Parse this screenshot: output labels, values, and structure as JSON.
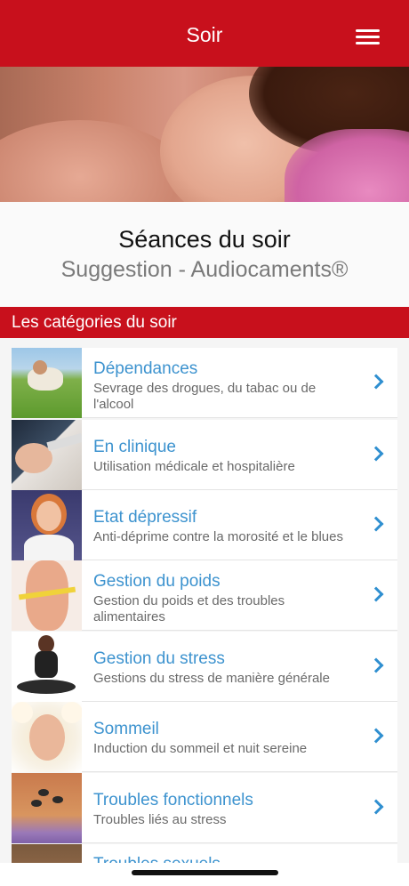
{
  "header": {
    "title": "Soir",
    "menu_icon": "hamburger-menu-icon"
  },
  "hero": {
    "image": "sleeping-woman-photo"
  },
  "intro": {
    "title": "Séances du soir",
    "subtitle": "Suggestion - Audiocaments®"
  },
  "section": {
    "label": "Les catégories du soir"
  },
  "categories": [
    {
      "title": "Dépendances",
      "desc": "Sevrage des drogues, du tabac ou de l'alcool",
      "thumb": "man-lying-in-grass"
    },
    {
      "title": "En clinique",
      "desc": "Utilisation médicale et hospitalière",
      "thumb": "dental-examination"
    },
    {
      "title": "Etat dépressif",
      "desc": "Anti-déprime contre la morosité et le blues",
      "thumb": "woman-holding-cup"
    },
    {
      "title": "Gestion du poids",
      "desc": "Gestion du poids et des troubles alimentaires",
      "thumb": "waist-measuring-tape"
    },
    {
      "title": "Gestion du stress",
      "desc": "Gestions du stress de manière générale",
      "thumb": "woman-meditating"
    },
    {
      "title": "Sommeil",
      "desc": "Induction du sommeil et nuit sereine",
      "thumb": "face-among-flowers"
    },
    {
      "title": "Troubles fonctionnels",
      "desc": "Troubles liés au stress",
      "thumb": "massage-stones"
    },
    {
      "title": "Troubles sexuels",
      "desc": "",
      "thumb": "couple-photo"
    }
  ],
  "colors": {
    "brand_red": "#c8101c",
    "link_blue": "#3d93cf",
    "chevron_blue": "#2f8fd0"
  }
}
